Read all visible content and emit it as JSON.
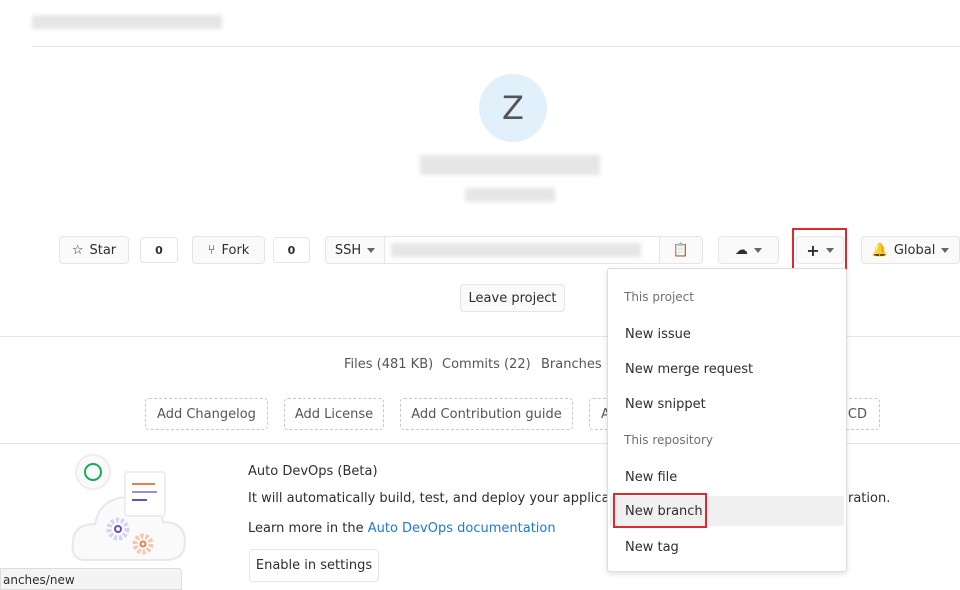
{
  "project": {
    "avatar_letter": "Z",
    "avatar_color": "#e1f0fb"
  },
  "toolbar": {
    "star_label": "Star",
    "star_count": "0",
    "fork_label": "Fork",
    "fork_count": "0",
    "clone_protocol": "SSH",
    "notification_label": "Global"
  },
  "leave_project": "Leave project",
  "stats": {
    "files": "Files (481 KB)",
    "commits": "Commits (22)",
    "branches": "Branches ("
  },
  "suggestions": [
    "Add Changelog",
    "Add License",
    "Add Contribution guide",
    "A",
    "CD"
  ],
  "autodevops": {
    "title": "Auto DevOps (Beta)",
    "description": "It will automatically build, test, and deploy your application",
    "description_tail": "ration.",
    "learn_prefix": "Learn more in the ",
    "learn_link": "Auto DevOps documentation",
    "enable_button": "Enable in settings"
  },
  "dropdown": {
    "header_project": "This project",
    "items_project": [
      "New issue",
      "New merge request",
      "New snippet"
    ],
    "header_repo": "This repository",
    "items_repo": [
      "New file",
      "New branch",
      "New tag"
    ]
  },
  "status_bar": "anches/new",
  "highlight_color": "#e0282e"
}
